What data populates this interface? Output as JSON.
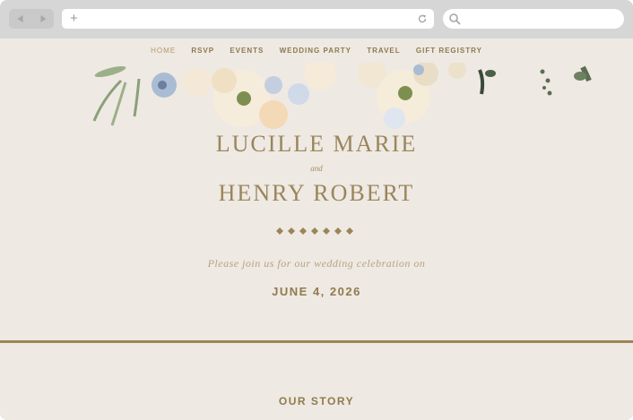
{
  "browser": {
    "back_icon": "back-arrow-icon",
    "forward_icon": "forward-arrow-icon",
    "new_tab_symbol": "+",
    "reload_icon": "reload-icon",
    "search_icon": "search-icon",
    "address_value": "",
    "search_value": ""
  },
  "nav": {
    "items": [
      {
        "label": "HOME",
        "active": true
      },
      {
        "label": "RSVP",
        "active": false
      },
      {
        "label": "EVENTS",
        "active": false
      },
      {
        "label": "WEDDING PARTY",
        "active": false
      },
      {
        "label": "TRAVEL",
        "active": false
      },
      {
        "label": "GIFT REGISTRY",
        "active": false
      }
    ]
  },
  "hero": {
    "name1": "LUCILLE MARIE",
    "and": "and",
    "name2": "HENRY ROBERT",
    "invite": "Please join us for our wedding celebration on",
    "date": "JUNE 4, 2026"
  },
  "section": {
    "title": "OUR STORY"
  },
  "colors": {
    "page_bg": "#efe9e3",
    "accent_gold": "#9b8558",
    "text_gold": "#8f7b4c",
    "chrome_gray": "#d6d6d6"
  }
}
